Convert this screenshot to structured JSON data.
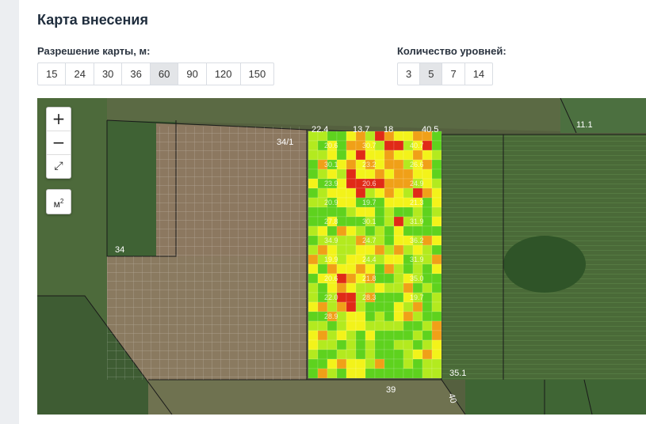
{
  "title": "Карта внесения",
  "resolution": {
    "label": "Разрешение карты, м:",
    "options": [
      "15",
      "24",
      "30",
      "36",
      "60",
      "90",
      "120",
      "150"
    ],
    "selected": "60"
  },
  "levels": {
    "label": "Количество уровней:",
    "options": [
      "3",
      "5",
      "7",
      "14"
    ],
    "selected": "5"
  },
  "map_controls": {
    "zoom_in": "+",
    "zoom_out": "−",
    "fullscreen": "⤢",
    "area_unit": "м",
    "area_sup": "2"
  },
  "field_labels": {
    "l34_1": "34/1",
    "l34": "34",
    "l11_1": "11.1",
    "l35_1": "35.1",
    "l39": "39",
    "l40": "40",
    "top1": "22.4",
    "top2": "13.7",
    "top3": "18",
    "top4": "40.5"
  },
  "colors": {
    "level1": "#5ed21e",
    "level2": "#b3ea1f",
    "level3": "#f3f31a",
    "level4": "#f0a018",
    "level5": "#e02a17"
  },
  "grid_values": [
    "20.6",
    "30.7",
    "40.7",
    "30.1",
    "23.2",
    "26.6",
    "23.9",
    "20.6",
    "24.9",
    "20.9",
    "19.7",
    "21.3",
    "27.8",
    "30.1",
    "31.9",
    "34.9",
    "24.7",
    "36.2",
    "19.9",
    "24.4",
    "31.9",
    "20.6",
    "21.8",
    "35.0",
    "22.0",
    "28.3",
    "19.7",
    "28.9"
  ]
}
